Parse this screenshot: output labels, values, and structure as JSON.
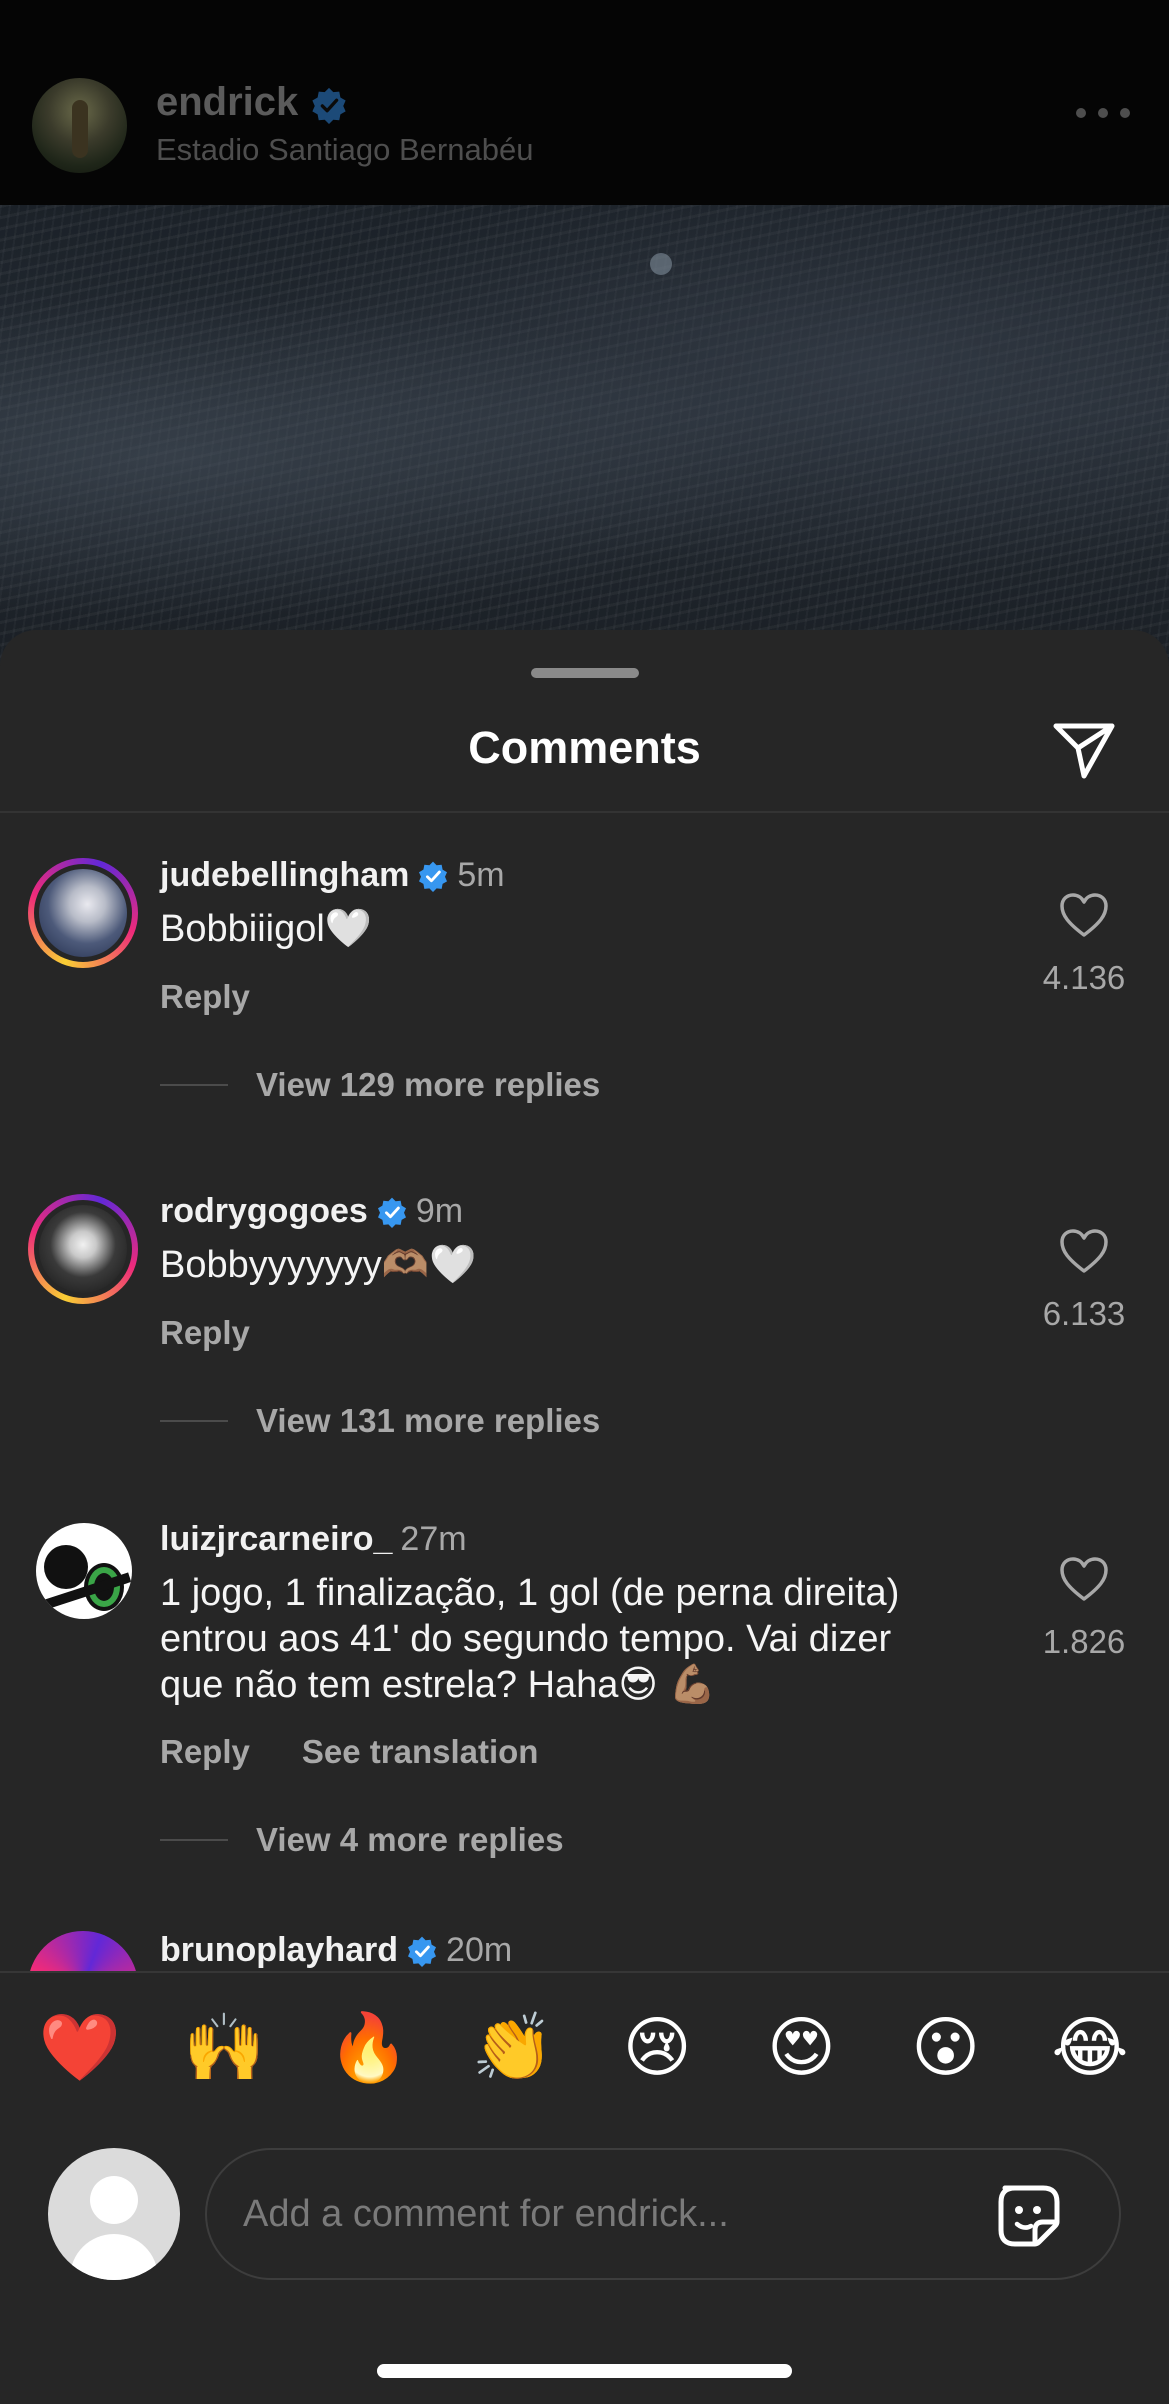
{
  "post": {
    "username": "endrick",
    "location": "Estadio Santiago Bernabéu",
    "more_icon": "more-horizontal-icon"
  },
  "sheet": {
    "title": "Comments",
    "share_icon": "paper-plane-icon"
  },
  "comments": [
    {
      "username": "judebellingham",
      "verified": true,
      "time": "5m",
      "text": "Bobbiiigol🤍",
      "likes": "4.136",
      "reply_label": "Reply",
      "view_replies": "View 129 more replies"
    },
    {
      "username": "rodrygogoes",
      "verified": true,
      "time": "9m",
      "text": "Bobbyyyyyyy🫶🏽🤍",
      "likes": "6.133",
      "reply_label": "Reply",
      "view_replies": "View 131 more replies"
    },
    {
      "username": "luizjrcarneiro_",
      "verified": false,
      "time": "27m",
      "text": "1 jogo, 1 finalização, 1 gol (de perna direita) entrou aos 41' do segundo tempo. Vai dizer que não tem estrela? Haha😎 💪🏽",
      "likes": "1.826",
      "reply_label": "Reply",
      "translate_label": "See translation",
      "view_replies": "View 4 more replies"
    },
    {
      "username": "brunoplayhard",
      "verified": true,
      "time": "20m"
    }
  ],
  "reactions": [
    "❤️",
    "🙌",
    "🔥",
    "👏",
    "😢",
    "😍",
    "😮",
    "😂"
  ],
  "composer": {
    "placeholder": "Add a comment for endrick...",
    "sticker_icon": "sticker-icon"
  },
  "colors": {
    "sheet_bg": "#262626",
    "verified_blue": "#3797f0",
    "muted_text": "#a8a8a8"
  }
}
